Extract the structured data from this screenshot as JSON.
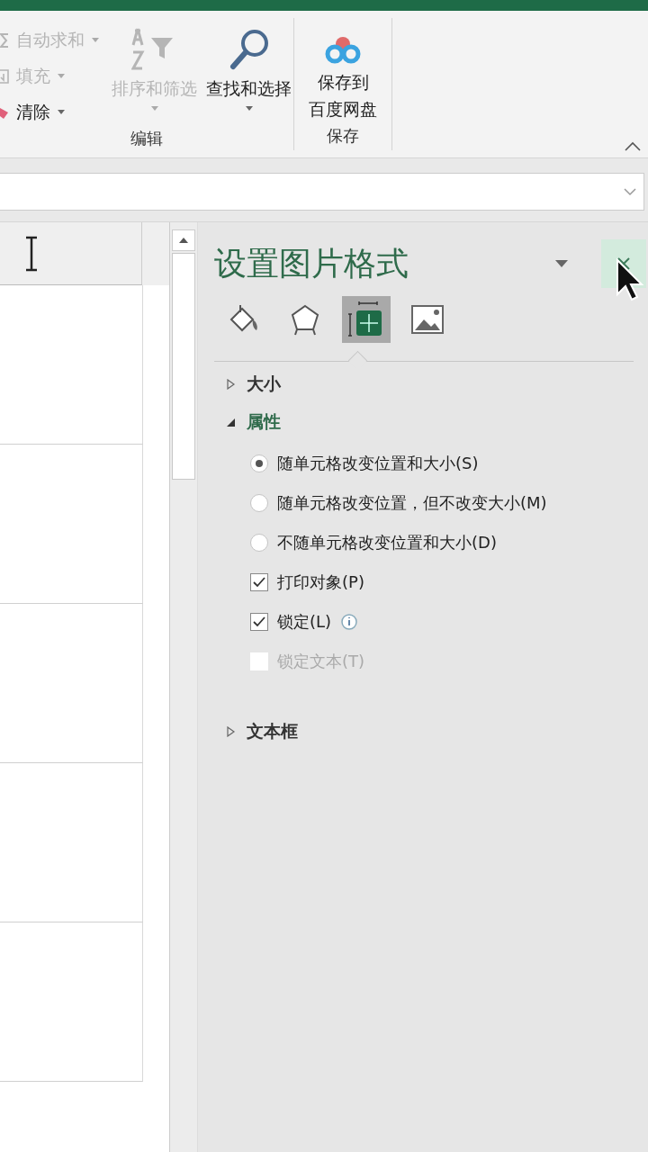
{
  "ribbon": {
    "editing_group": {
      "label": "编辑",
      "small_buttons": [
        {
          "label": "自动求和",
          "disabled": true,
          "kind": "sum"
        },
        {
          "label": "填充",
          "disabled": true,
          "kind": "fill"
        },
        {
          "label": "清除",
          "disabled": false,
          "kind": "clear"
        }
      ],
      "sort_button": {
        "label": "排序和筛选",
        "disabled": true
      },
      "find_button": {
        "label": "查找和选择",
        "disabled": false
      }
    },
    "save_group": {
      "label": "保存",
      "button_lines": [
        "保存到",
        "百度网盘"
      ]
    }
  },
  "pane": {
    "title": "设置图片格式",
    "close_button": {
      "hovered": true
    },
    "tabs": [
      {
        "kind": "fill",
        "selected": false
      },
      {
        "kind": "shape",
        "selected": false
      },
      {
        "kind": "size",
        "selected": true
      },
      {
        "kind": "picture",
        "selected": false
      }
    ],
    "sections": [
      {
        "label": "大小",
        "expanded": false
      },
      {
        "label": "属性",
        "expanded": true,
        "options": [
          {
            "kind": "radio",
            "label": "随单元格改变位置和大小(S)",
            "selected": true
          },
          {
            "kind": "radio",
            "label": "随单元格改变位置，但不改变大小(M)",
            "selected": false
          },
          {
            "kind": "radio",
            "label": "不随单元格改变位置和大小(D)",
            "selected": false
          },
          {
            "kind": "checkbox",
            "label": "打印对象(P)",
            "checked": true,
            "disabled": false
          },
          {
            "kind": "checkbox",
            "label": "锁定(L)",
            "checked": true,
            "disabled": false,
            "info": true
          },
          {
            "kind": "checkbox",
            "label": "锁定文本(T)",
            "checked": false,
            "disabled": true
          }
        ]
      },
      {
        "label": "文本框",
        "expanded": false
      }
    ]
  }
}
